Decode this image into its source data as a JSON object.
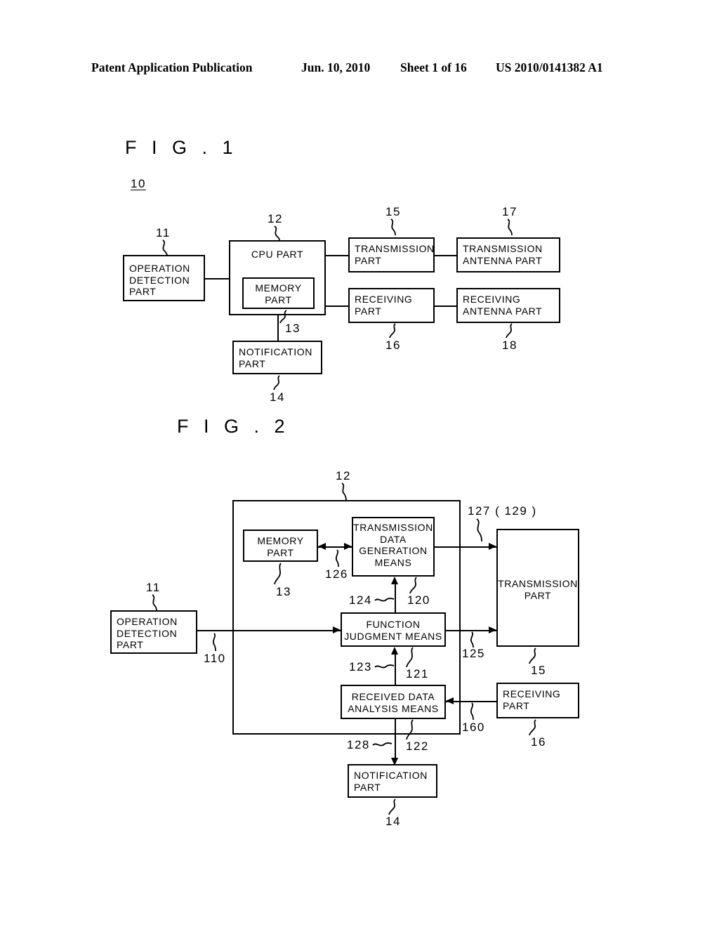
{
  "header": {
    "publication": "Patent Application Publication",
    "date": "Jun. 10, 2010",
    "sheet": "Sheet 1 of 16",
    "document_number": "US 2010/0141382 A1"
  },
  "figures": [
    {
      "title": "F I G . 1",
      "system_ref": "10",
      "boxes": {
        "operation_detection": "OPERATION\nDETECTION\nPART",
        "cpu": "CPU PART",
        "memory": "MEMORY\nPART",
        "notification": "NOTIFICATION\nPART",
        "transmission": "TRANSMISSION\nPART",
        "receiving": "RECEIVING\nPART",
        "transmission_antenna": "TRANSMISSION\nANTENNA PART",
        "receiving_antenna": "RECEIVING\nANTENNA PART"
      },
      "refs": {
        "operation_detection": "11",
        "cpu": "12",
        "memory": "13",
        "notification": "14",
        "transmission": "15",
        "receiving": "16",
        "transmission_antenna": "17",
        "receiving_antenna": "18"
      }
    },
    {
      "title": "F I G . 2",
      "boxes": {
        "cpu": "",
        "memory": "MEMORY\nPART",
        "transmission_data_generation": "TRANSMISSION\nDATA\nGENERATION\nMEANS",
        "function_judgment": "FUNCTION\nJUDGMENT MEANS",
        "received_data_analysis": "RECEIVED DATA\nANALYSIS MEANS",
        "operation_detection": "OPERATION\nDETECTION\nPART",
        "transmission": "TRANSMISSION\nPART",
        "receiving": "RECEIVING\nPART",
        "notification": "NOTIFICATION\nPART"
      },
      "refs": {
        "cpu": "12",
        "memory": "13",
        "operation_detection": "11",
        "operation_signal_line": "110",
        "transmission_data_generation": "120",
        "function_judgment": "121",
        "received_data_analysis": "122",
        "analysis_to_judgment": "123",
        "judgment_to_generation": "124",
        "judgment_to_transmission": "125",
        "memory_to_generation": "126",
        "generation_to_transmission": "127 ( 129 )",
        "analysis_to_notification": "128",
        "receiving_to_analysis": "160",
        "transmission": "15",
        "receiving": "16",
        "notification": "14"
      }
    }
  ]
}
